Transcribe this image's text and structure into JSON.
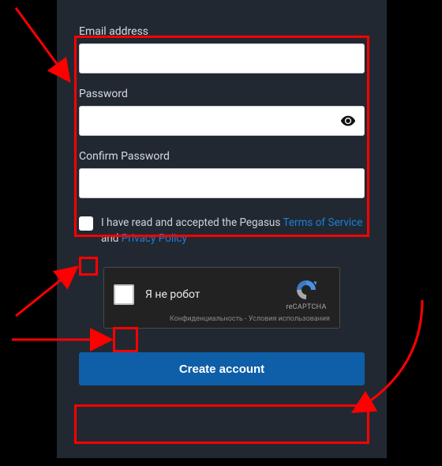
{
  "form": {
    "email_label": "Email address",
    "password_label": "Password",
    "confirm_label": "Confirm Password"
  },
  "terms": {
    "prefix": "I have read and accepted the Pegasus ",
    "tos": "Terms of Service",
    "and": " and ",
    "privacy": "Privacy Policy"
  },
  "captcha": {
    "label": "Я не робот",
    "brand": "reCAPTCHA",
    "footer": "Конфиденциальность - Условия использования"
  },
  "submit": {
    "label": "Create account"
  }
}
